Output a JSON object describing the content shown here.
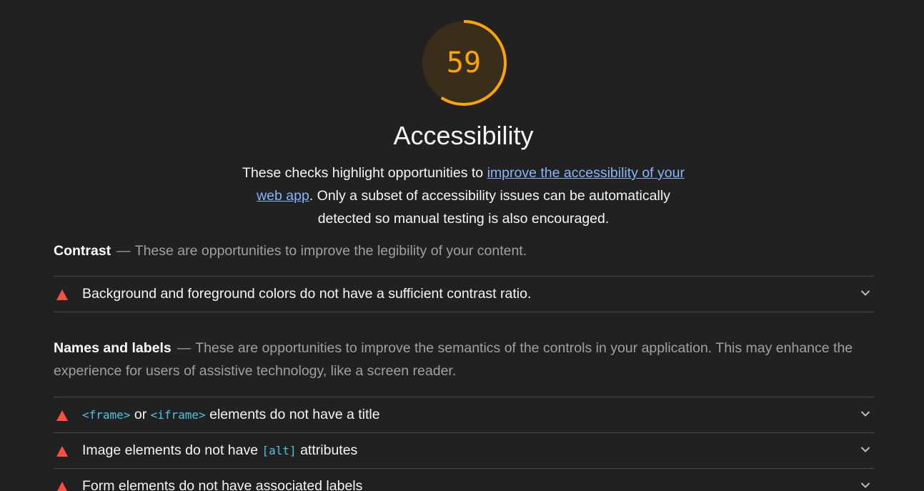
{
  "category": {
    "score": "59",
    "score_fraction": 0.59,
    "score_color": "#ffa400",
    "title": "Accessibility",
    "description_before": "These checks highlight opportunities to ",
    "description_link": "improve the accessibility of your web app",
    "description_after": ". Only a subset of accessibility issues can be automatically detected so manual testing is also encouraged."
  },
  "groups": [
    {
      "title": "Contrast",
      "separator": "—",
      "description": "These are opportunities to improve the legibility of your content.",
      "audits": [
        {
          "title": "Background and foreground colors do not have a sufficient contrast ratio."
        }
      ]
    },
    {
      "title": "Names and labels",
      "separator": "—",
      "description": "These are opportunities to improve the semantics of the controls in your application. This may enhance the experience for users of assistive technology, like a screen reader.",
      "audits": [
        {
          "code1": "<frame>",
          "mid": " or ",
          "code2": "<iframe>",
          "rest": " elements do not have a title"
        },
        {
          "before": "Image elements do not have ",
          "code": "[alt]",
          "after": " attributes"
        },
        {
          "title": "Form elements do not have associated labels"
        }
      ]
    }
  ],
  "icons": {
    "fail": "fail-triangle-icon",
    "expand": "chevron-down-icon"
  },
  "colors": {
    "background": "#212121",
    "fail": "#ff4e42",
    "average": "#ffa400",
    "link": "#8ab4f8",
    "code": "#4fc3e0"
  }
}
